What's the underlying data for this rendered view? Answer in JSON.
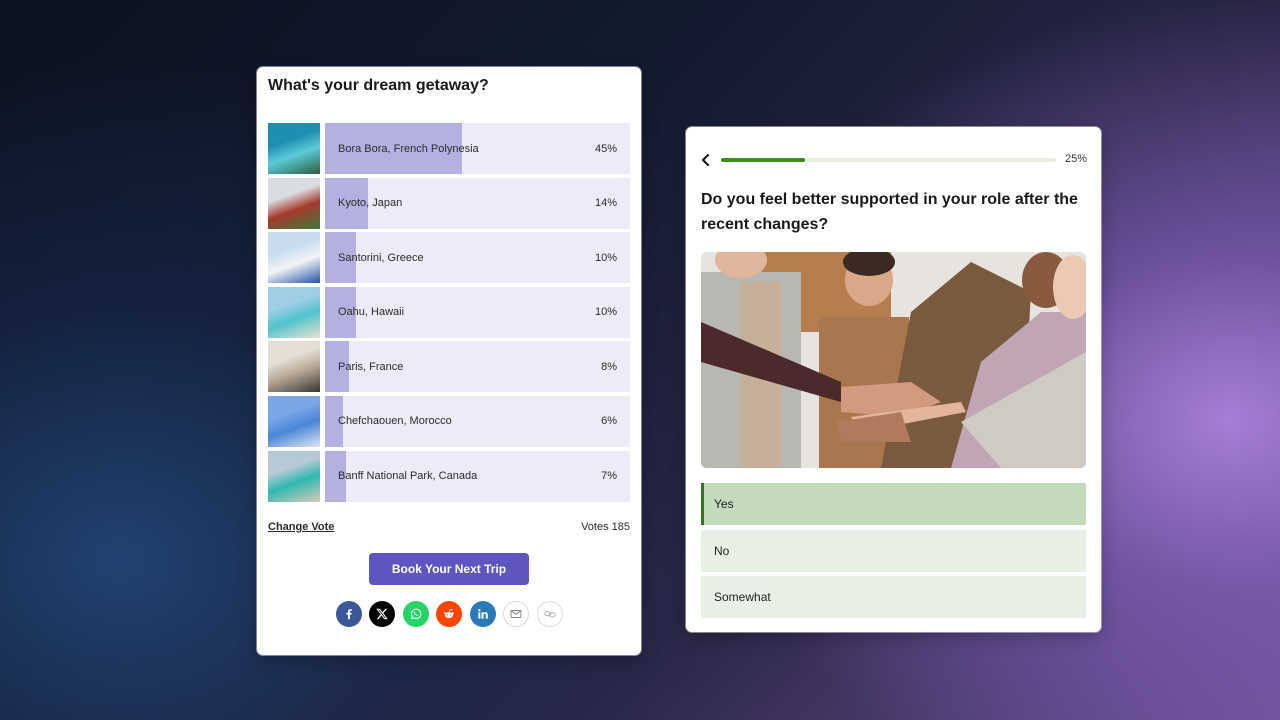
{
  "poll": {
    "title": "What's your dream getaway?",
    "options": [
      {
        "label": "Bora Bora, French Polynesia",
        "percent_label": "45%",
        "percent": 45,
        "thumbnail": "island-resort-photo",
        "colors": [
          "#1e8fb0",
          "#5ccbd8",
          "#2c5e3a"
        ]
      },
      {
        "label": "Kyoto, Japan",
        "percent_label": "14%",
        "percent": 14,
        "thumbnail": "pagoda-photo",
        "colors": [
          "#d9dde2",
          "#a63a2c",
          "#3c7a3a"
        ]
      },
      {
        "label": "Santorini, Greece",
        "percent_label": "10%",
        "percent": 10,
        "thumbnail": "blue-dome-photo",
        "colors": [
          "#c9dcee",
          "#f2f4f7",
          "#2553a8"
        ]
      },
      {
        "label": "Oahu, Hawaii",
        "percent_label": "10%",
        "percent": 10,
        "thumbnail": "beach-photo",
        "colors": [
          "#9fcfe6",
          "#4fc3cf",
          "#e9e2cf"
        ]
      },
      {
        "label": "Paris, France",
        "percent_label": "8%",
        "percent": 8,
        "thumbnail": "eiffel-tower-photo",
        "colors": [
          "#e4ded4",
          "#b8a996",
          "#3a3430"
        ]
      },
      {
        "label": "Chefchaouen, Morocco",
        "percent_label": "6%",
        "percent": 6,
        "thumbnail": "blue-street-photo",
        "colors": [
          "#7aa6e8",
          "#4a86d6",
          "#dbe6f5"
        ]
      },
      {
        "label": "Banff National Park, Canada",
        "percent_label": "7%",
        "percent": 7,
        "thumbnail": "lake-mountain-photo",
        "colors": [
          "#b7c9d6",
          "#2fb8b0",
          "#d9cbb8"
        ]
      }
    ],
    "change_vote_label": "Change Vote",
    "votes_label": "Votes 185",
    "cta_label": "Book Your Next Trip",
    "share": [
      {
        "name": "facebook",
        "color": "#3b5998"
      },
      {
        "name": "x",
        "color": "#000000"
      },
      {
        "name": "whatsapp",
        "color": "#25d366"
      },
      {
        "name": "reddit",
        "color": "#ff4500"
      },
      {
        "name": "linkedin",
        "color": "#2a7ab8"
      },
      {
        "name": "email",
        "color": "#ffffff"
      },
      {
        "name": "copy-link",
        "color": "#ffffff"
      }
    ],
    "colors": {
      "bar_fill": "#b5b0e2",
      "bar_track": "#edebf8",
      "cta": "#5f55c0"
    }
  },
  "survey": {
    "progress_label": "25%",
    "progress": 25,
    "question": "Do you feel better supported in your role after the recent changes?",
    "image": "team-hands-stacked-photo",
    "options": [
      {
        "label": "Yes",
        "selected": true
      },
      {
        "label": "No",
        "selected": false
      },
      {
        "label": "Somewhat",
        "selected": false
      }
    ],
    "colors": {
      "accent": "#3f8c1e",
      "option_bg": "#e8f0e5",
      "option_selected_bg": "#c4dabd"
    }
  }
}
